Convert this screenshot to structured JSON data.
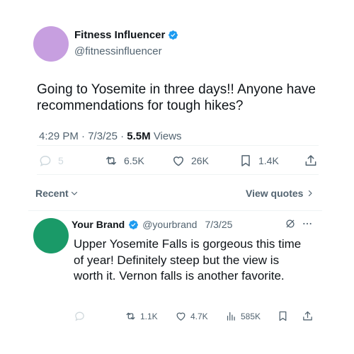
{
  "post": {
    "author_name": "Fitness Influencer",
    "author_handle": "@fitnessinfluencer",
    "text": "Going to Yosemite in three days!! Anyone have recommendations for tough hikes?",
    "time": "4:29 PM",
    "date": "7/3/25",
    "views_count": "5.5M",
    "views_label": "Views",
    "avatar_color": "#c79fe0",
    "actions": {
      "replies": "5",
      "reposts": "6.5K",
      "likes": "26K",
      "bookmarks": "1.4K"
    }
  },
  "sort": {
    "label": "Recent",
    "view_quotes_label": "View quotes"
  },
  "reply": {
    "author_name": "Your Brand",
    "author_handle": "@yourbrand",
    "date": "7/3/25",
    "text": "Upper Yosemite Falls is gorgeous this time of year! Definitely steep but the view is worth it. Vernon falls is another favorite.",
    "avatar_color": "#1a9a68",
    "actions": {
      "reposts": "1.1K",
      "likes": "4.7K",
      "views": "585K"
    }
  },
  "colors": {
    "verified": "#1d9bf0",
    "text_primary": "#0f1419",
    "text_secondary": "#536471",
    "divider": "#eff3f4"
  }
}
